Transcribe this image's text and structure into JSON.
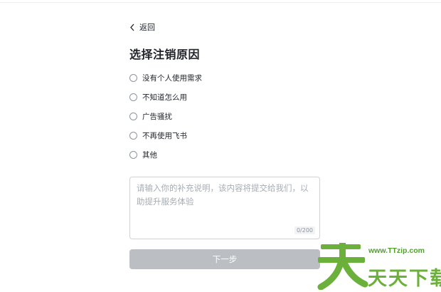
{
  "back": {
    "label": "返回",
    "icon": "chevron-left-icon"
  },
  "title": "选择注销原因",
  "reasons": [
    {
      "label": "没有个人使用需求",
      "selected": false
    },
    {
      "label": "不知道怎么用",
      "selected": false
    },
    {
      "label": "广告骚扰",
      "selected": false
    },
    {
      "label": "不再使用飞书",
      "selected": false
    },
    {
      "label": "其他",
      "selected": false
    }
  ],
  "feedback": {
    "placeholder": "请输入你的补充说明，该内容将提交给我们，以助提升服务体验",
    "value": "",
    "counter": "0/200"
  },
  "next_button": {
    "label": "下一步",
    "enabled": false
  },
  "watermark": {
    "url": "www.TTzip.com",
    "chars": "天天下载",
    "logo_char": "天"
  },
  "colors": {
    "text": "#1f2329",
    "placeholder": "#a7acb2",
    "button_disabled": "#bbbfc4",
    "watermark_green": "#6bb03a"
  }
}
